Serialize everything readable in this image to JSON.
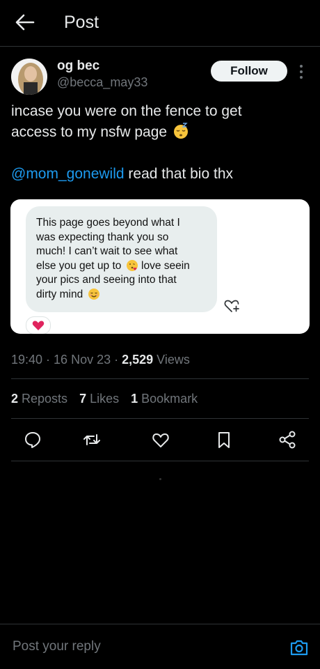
{
  "header": {
    "title": "Post"
  },
  "author": {
    "display_name": "og bec",
    "handle": "@becca_may33"
  },
  "follow_label": "Follow",
  "post": {
    "line1": "incase you were on the fence to get",
    "line2": "access to my nsfw page",
    "mention": "@mom_gonewild",
    "mention_rest": " read that bio thx"
  },
  "media": {
    "bubble_lines": [
      "This page goes beyond what I",
      "was expecting thank you so",
      "much! I can’t wait to see what",
      "else you get up to",
      "love seein",
      "your pics and seeing into that",
      "dirty mind"
    ]
  },
  "meta": {
    "time": "19:40",
    "sep1": " · ",
    "date": "16 Nov 23",
    "sep2": " · ",
    "views_count": "2,529",
    "views_label": " Views"
  },
  "stats": {
    "reposts_count": "2",
    "reposts_label": " Reposts",
    "likes_count": "7",
    "likes_label": " Likes",
    "bookmarks_count": "1",
    "bookmarks_label": " Bookmark"
  },
  "reply": {
    "placeholder": "Post your reply"
  },
  "colors": {
    "accent": "#1d9bf0",
    "background": "#000000",
    "text": "#e7e9ea",
    "muted": "#71767b",
    "divider": "#2f3336"
  },
  "icons": [
    "back-arrow-icon",
    "more-vertical-icon",
    "reply-icon",
    "repost-icon",
    "like-icon",
    "bookmark-icon",
    "share-icon",
    "camera-icon",
    "heart-plus-icon",
    "heart-reaction-icon"
  ]
}
